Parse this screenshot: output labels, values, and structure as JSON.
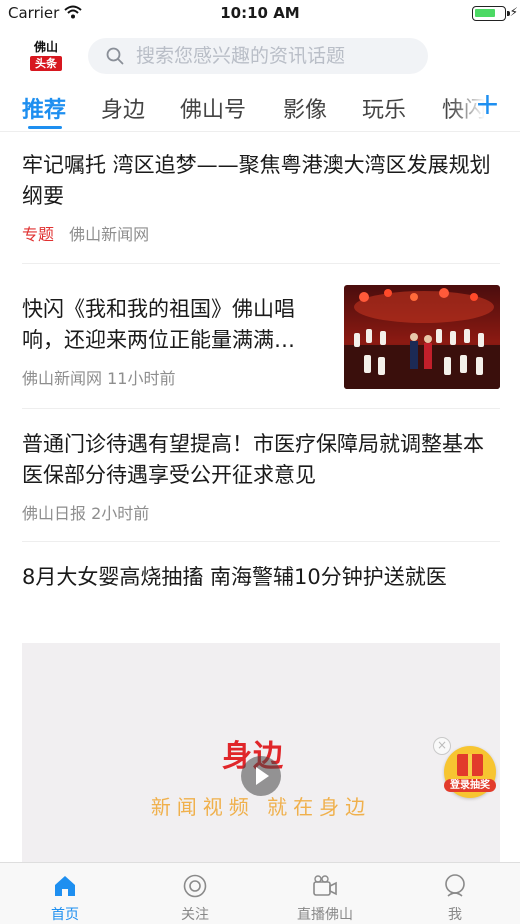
{
  "status_bar": {
    "carrier": "Carrier",
    "time": "10:10 AM"
  },
  "header": {
    "logo_line1": "佛山",
    "logo_line2": "头条",
    "search_placeholder": "搜索您感兴趣的资讯话题"
  },
  "tabs": [
    {
      "label": "推荐",
      "active": true
    },
    {
      "label": "身边"
    },
    {
      "label": "佛山号"
    },
    {
      "label": "影像"
    },
    {
      "label": "玩乐"
    },
    {
      "label": "快闪"
    }
  ],
  "feed": [
    {
      "title": "牢记嘱托 湾区追梦——聚焦粤港澳大湾区发展规划纲要",
      "tag": "专题",
      "source": "佛山新闻网",
      "time": ""
    },
    {
      "title": "快闪《我和我的祖国》佛山唱响，还迎来两位正能量满满…",
      "source": "佛山新闻网",
      "time": "11小时前"
    },
    {
      "title": "普通门诊待遇有望提高！市医疗保障局就调整基本医保部分待遇享受公开征求意见",
      "source": "佛山日报",
      "time": "2小时前"
    },
    {
      "title": "8月大女婴高烧抽搐 南海警辅10分钟护送就医"
    }
  ],
  "video": {
    "logo_text": "身边",
    "slogan": "新闻视频 就在身边"
  },
  "promo": {
    "label": "登录抽奖"
  },
  "bottom_nav": [
    {
      "label": "首页",
      "icon": "home-icon",
      "active": true
    },
    {
      "label": "关注",
      "icon": "follow-icon"
    },
    {
      "label": "直播佛山",
      "icon": "camera-icon"
    },
    {
      "label": "我",
      "icon": "profile-icon"
    }
  ],
  "colors": {
    "accent": "#1e8ff0",
    "tag_red": "#e03131",
    "brand_red": "#d7171f"
  }
}
